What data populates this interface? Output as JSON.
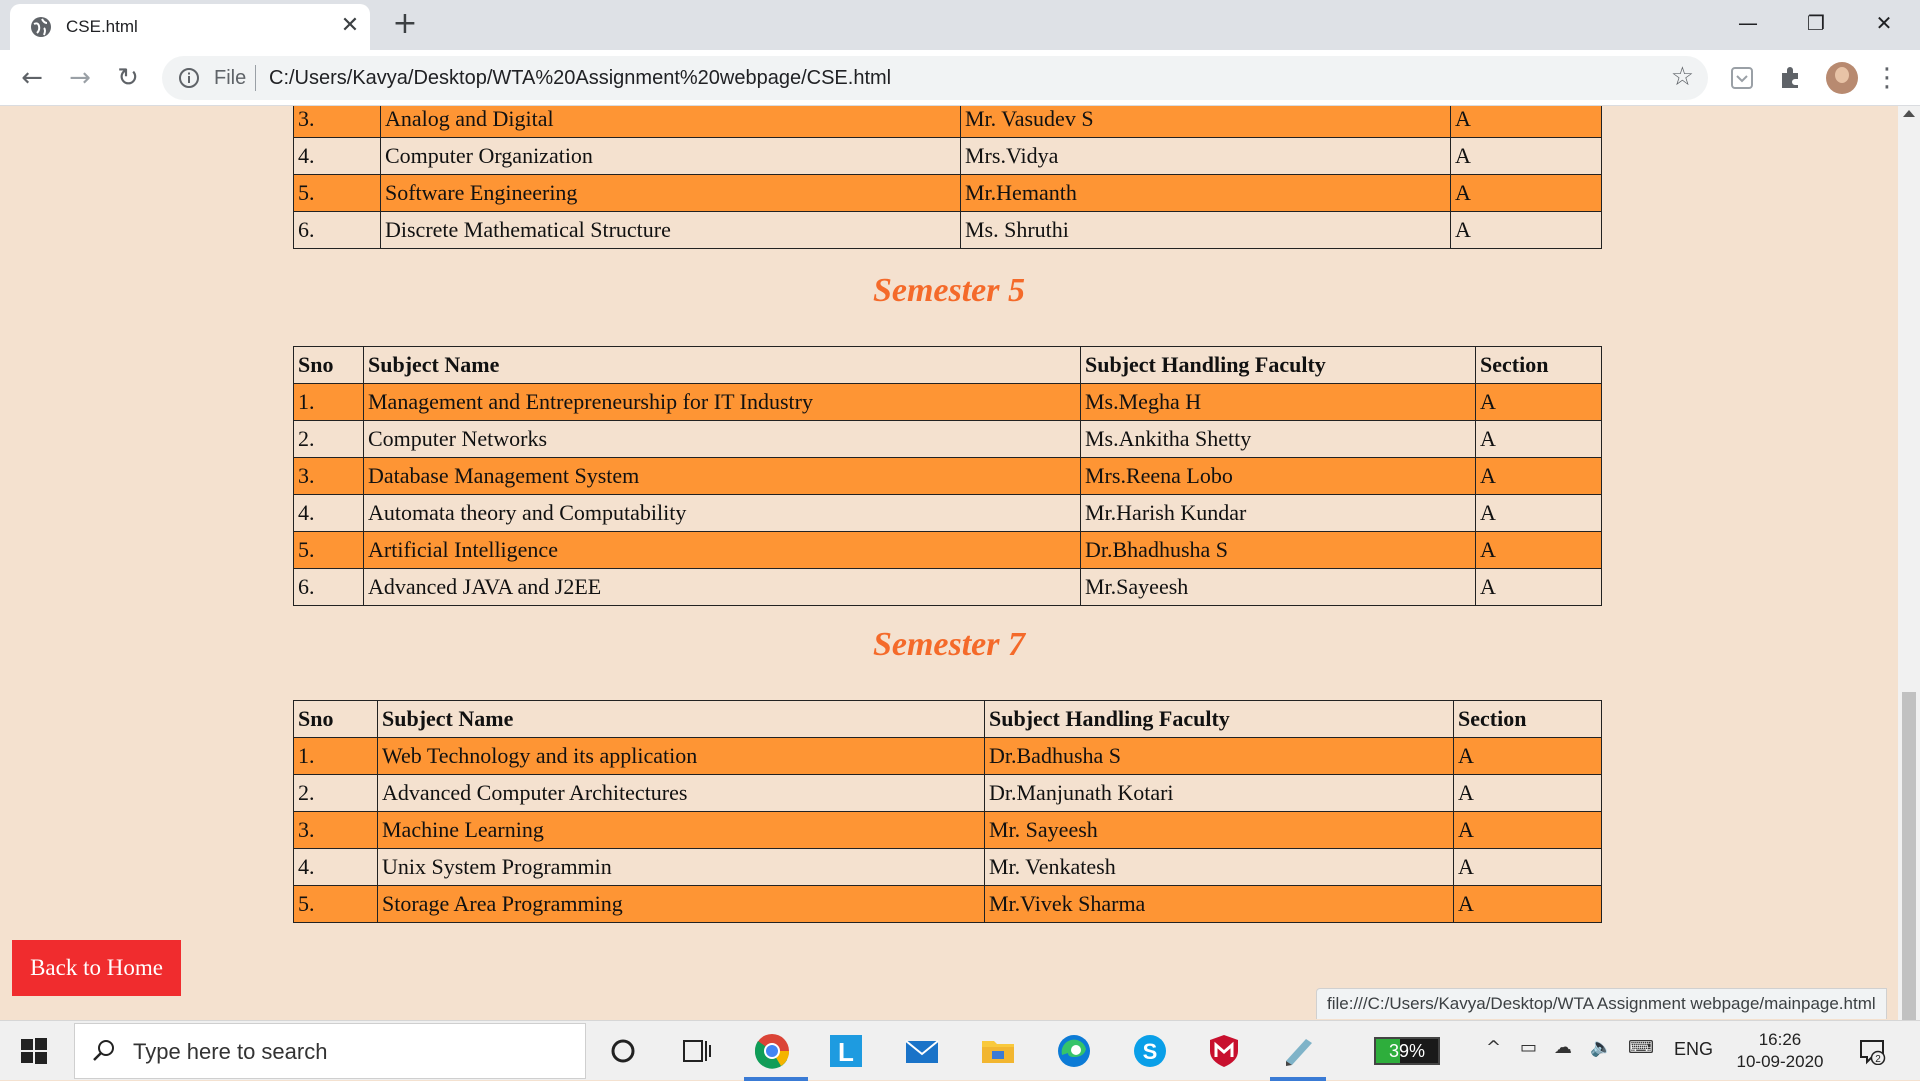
{
  "browser": {
    "tab_title": "CSE.html",
    "scheme_label": "File",
    "url": "C:/Users/Kavya/Desktop/WTA%20Assignment%20webpage/CSE.html",
    "status_link": "file:///C:/Users/Kavya/Desktop/WTA Assignment webpage/mainpage.html"
  },
  "page": {
    "partial_table": {
      "rows": [
        {
          "sno": "3.",
          "subject": "Analog and Digital",
          "faculty": "Mr. Vasudev S",
          "section": "A"
        },
        {
          "sno": "4.",
          "subject": "Computer Organization",
          "faculty": "Mrs.Vidya",
          "section": "A"
        },
        {
          "sno": "5.",
          "subject": "Software Engineering",
          "faculty": "Mr.Hemanth",
          "section": "A"
        },
        {
          "sno": "6.",
          "subject": "Discrete Mathematical Structure",
          "faculty": "Ms. Shruthi",
          "section": "A"
        }
      ]
    },
    "semester5": {
      "title": "Semester 5",
      "headers": {
        "sno": "Sno",
        "subject": "Subject Name",
        "faculty": "Subject Handling Faculty",
        "section": "Section"
      },
      "rows": [
        {
          "sno": "1.",
          "subject": "Management and Entrepreneurship for IT Industry",
          "faculty": "Ms.Megha H",
          "section": "A"
        },
        {
          "sno": "2.",
          "subject": "Computer Networks",
          "faculty": "Ms.Ankitha Shetty",
          "section": "A"
        },
        {
          "sno": "3.",
          "subject": "Database Management System",
          "faculty": "Mrs.Reena Lobo",
          "section": "A"
        },
        {
          "sno": "4.",
          "subject": "Automata theory and Computability",
          "faculty": "Mr.Harish Kundar",
          "section": "A"
        },
        {
          "sno": "5.",
          "subject": "Artificial Intelligence",
          "faculty": "Dr.Bhadhusha S",
          "section": "A"
        },
        {
          "sno": "6.",
          "subject": "Advanced JAVA and J2EE",
          "faculty": "Mr.Sayeesh",
          "section": "A"
        }
      ]
    },
    "semester7": {
      "title": "Semester 7",
      "headers": {
        "sno": "Sno",
        "subject": "Subject Name",
        "faculty": "Subject Handling Faculty",
        "section": "Section"
      },
      "rows": [
        {
          "sno": "1.",
          "subject": "Web Technology and its application",
          "faculty": "Dr.Badhusha S",
          "section": "A"
        },
        {
          "sno": "2.",
          "subject": "Advanced Computer Architectures",
          "faculty": "Dr.Manjunath Kotari",
          "section": "A"
        },
        {
          "sno": "3.",
          "subject": "Machine Learning",
          "faculty": "Mr. Sayeesh",
          "section": "A"
        },
        {
          "sno": "4.",
          "subject": "Unix System Programmin",
          "faculty": "Mr. Venkatesh",
          "section": "A"
        },
        {
          "sno": "5.",
          "subject": "Storage Area Programming",
          "faculty": "Mr.Vivek Sharma",
          "section": "A"
        }
      ]
    },
    "back_button": "Back to Home"
  },
  "taskbar": {
    "search_placeholder": "Type here to search",
    "battery_label": "39%",
    "battery_level": 0.39,
    "language": "ENG",
    "time": "16:26",
    "date": "10-09-2020",
    "notification_count": "2"
  },
  "colors": {
    "page_bg": "#f4e1cf",
    "row_highlight": "#fe9534",
    "semester_title": "#f46a2a",
    "back_button_bg": "#f02c2e"
  }
}
